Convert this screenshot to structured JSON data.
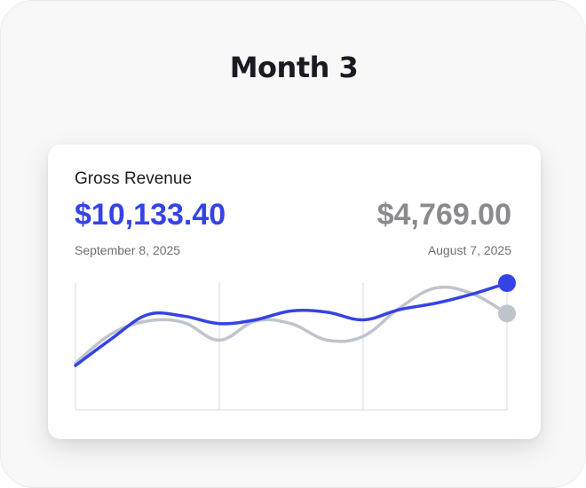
{
  "page": {
    "heading": "Month 3"
  },
  "card": {
    "title": "Gross Revenue",
    "current": {
      "value": "$10,133.40",
      "date": "September 8, 2025"
    },
    "previous": {
      "value": "$4,769.00",
      "date": "August 7, 2025"
    }
  },
  "colors": {
    "current": "#3443e6",
    "previous": "#bfc4cc",
    "grid": "#d9d9dc"
  },
  "chart_data": {
    "type": "line",
    "x": [
      0,
      1,
      2,
      3,
      4,
      5,
      6,
      7,
      8,
      9,
      10,
      11,
      12
    ],
    "xlim": [
      0,
      12
    ],
    "ylim": [
      0,
      100
    ],
    "grid": true,
    "series": [
      {
        "values": [
          35,
          56,
          75,
          74,
          68,
          71,
          78,
          77,
          71,
          79,
          84,
          91,
          100
        ]
      },
      {
        "values": [
          37,
          60,
          70,
          69,
          55,
          70,
          68,
          55,
          58,
          80,
          96,
          92,
          76
        ]
      }
    ]
  }
}
